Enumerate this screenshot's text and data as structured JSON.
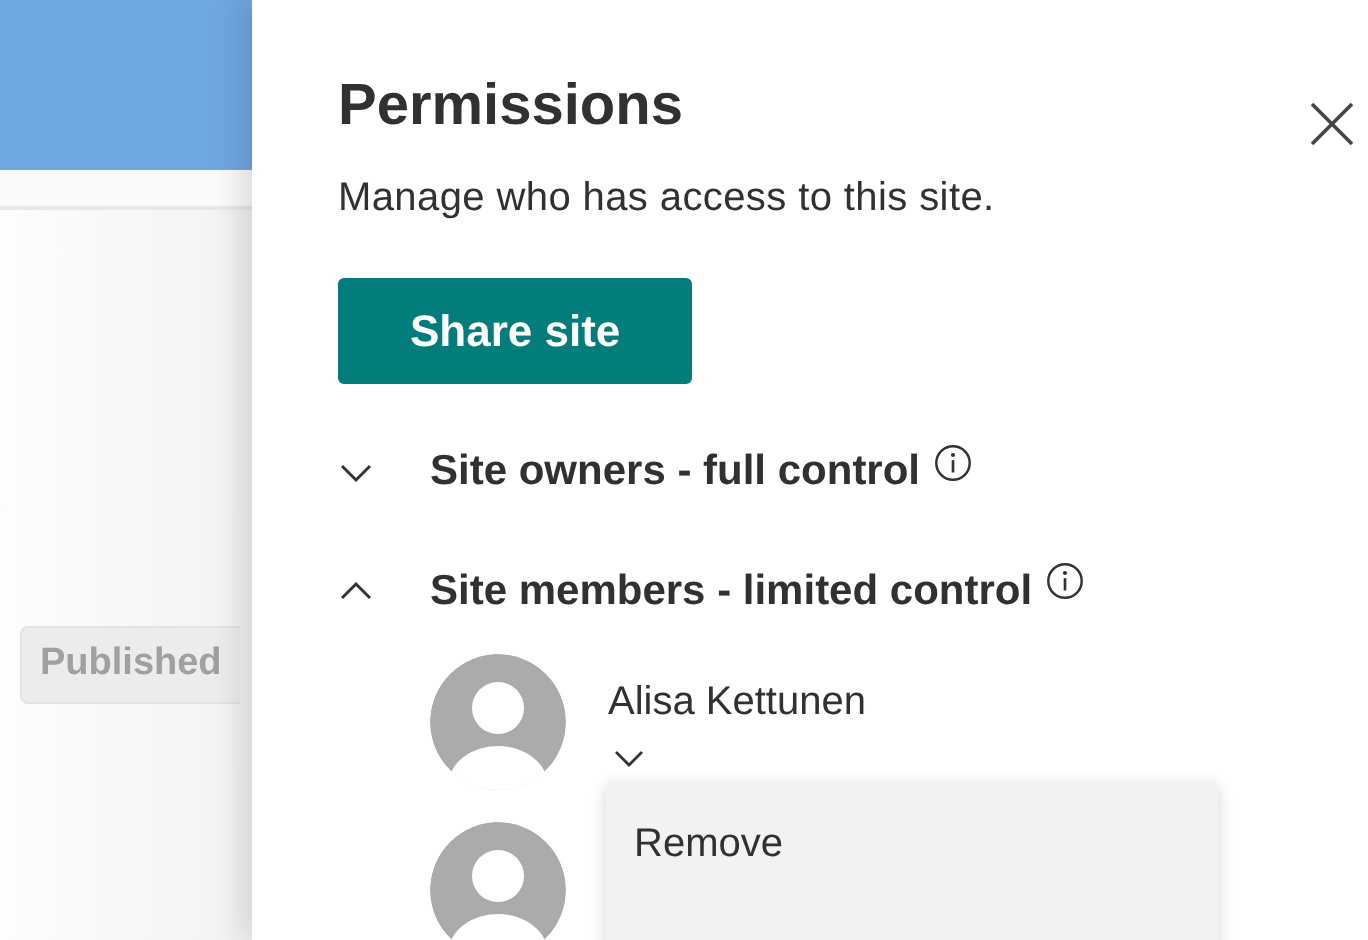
{
  "background_page": {
    "status_badge": "Published"
  },
  "panel": {
    "title": "Permissions",
    "description": "Manage who has access to this site.",
    "share_button": "Share site",
    "groups": [
      {
        "title": "Site owners - full control",
        "expanded": false
      },
      {
        "title": "Site members - limited control",
        "expanded": true,
        "members": [
          {
            "kind": "person",
            "name": "Alisa Kettunen",
            "menu_open": true,
            "menu_items": [
              "Remove"
            ]
          },
          {
            "kind": "avatar-only"
          }
        ]
      }
    ]
  }
}
